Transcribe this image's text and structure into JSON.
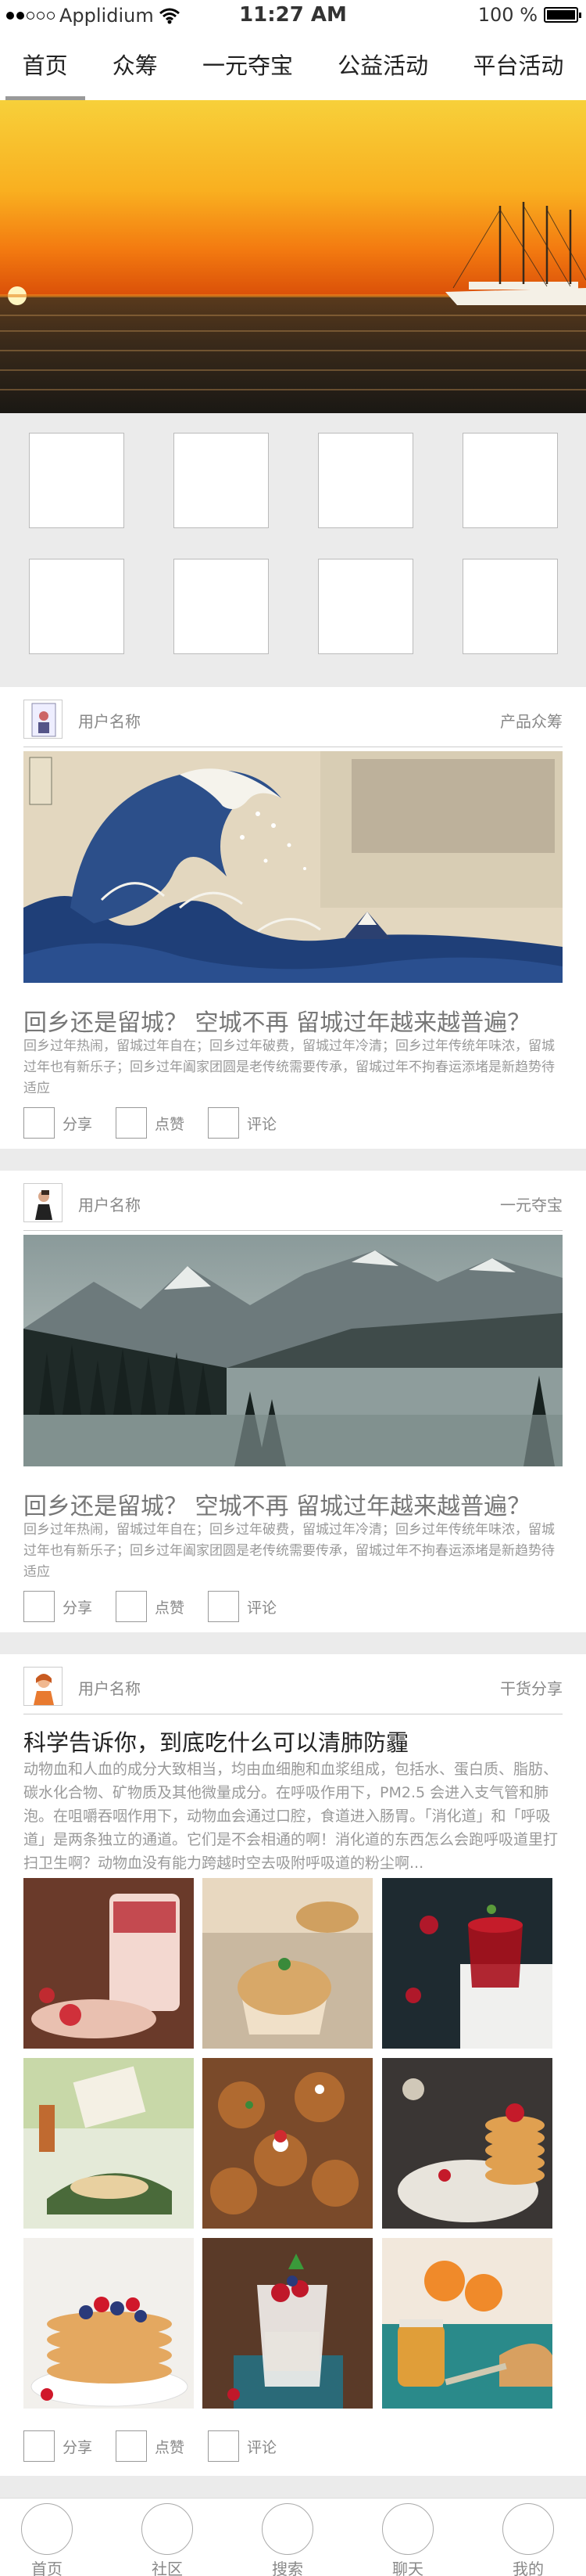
{
  "status_bar": {
    "carrier": "Applidium",
    "time": "11:27 AM",
    "battery": "100 %",
    "battery_level": 1.0
  },
  "top_tabs": [
    {
      "label": "首页",
      "active": true
    },
    {
      "label": "众筹",
      "active": false
    },
    {
      "label": "一元夺宝",
      "active": false
    },
    {
      "label": "公益活动",
      "active": false
    },
    {
      "label": "平台活动",
      "active": false
    }
  ],
  "cards": [
    {
      "username": "用户名称",
      "category": "产品众筹",
      "title": "回乡还是留城？ 空城不再 留城过年越来越普遍？",
      "excerpt": "回乡过年热闹，留城过年自在；回乡过年破费，留城过年冷清；回乡过年传统年味浓，留城过年也有新乐子；回乡过年阖家团圆是老传统需要传承，留城过年不拘春运添堵是新趋势待适应",
      "actions": {
        "share": "分享",
        "like": "点赞",
        "comment": "评论"
      }
    },
    {
      "username": "用户名称",
      "category": "一元夺宝",
      "title": "回乡还是留城？ 空城不再 留城过年越来越普遍？",
      "excerpt": "回乡过年热闹，留城过年自在；回乡过年破费，留城过年冷清；回乡过年传统年味浓，留城过年也有新乐子；回乡过年阖家团圆是老传统需要传承，留城过年不拘春运添堵是新趋势待适应",
      "actions": {
        "share": "分享",
        "like": "点赞",
        "comment": "评论"
      }
    },
    {
      "username": "用户名称",
      "category": "干货分享",
      "title": "科学告诉你，到底吃什么可以清肺防霾",
      "excerpt": "动物血和人血的成分大致相当，均由血细胞和血浆组成，包括水、蛋白质、脂肪、碳水化合物、矿物质及其他微量成分。在呼吸作用下，PM2.5 会进入支气管和肺泡。在咀嚼吞咽作用下，动物血会通过口腔，食道进入肠胃。「消化道」和「呼吸道」是两条独立的通道。它们是不会相通的啊！消化道的东西怎么会跑呼吸道里打扫卫生啊？动物血没有能力跨越时空去吸附呼吸道的粉尘啊...",
      "actions": {
        "share": "分享",
        "like": "点赞",
        "comment": "评论"
      }
    }
  ],
  "bottom_nav": [
    {
      "label": "首页"
    },
    {
      "label": "社区"
    },
    {
      "label": "搜索"
    },
    {
      "label": "聊天"
    },
    {
      "label": "我的"
    }
  ]
}
